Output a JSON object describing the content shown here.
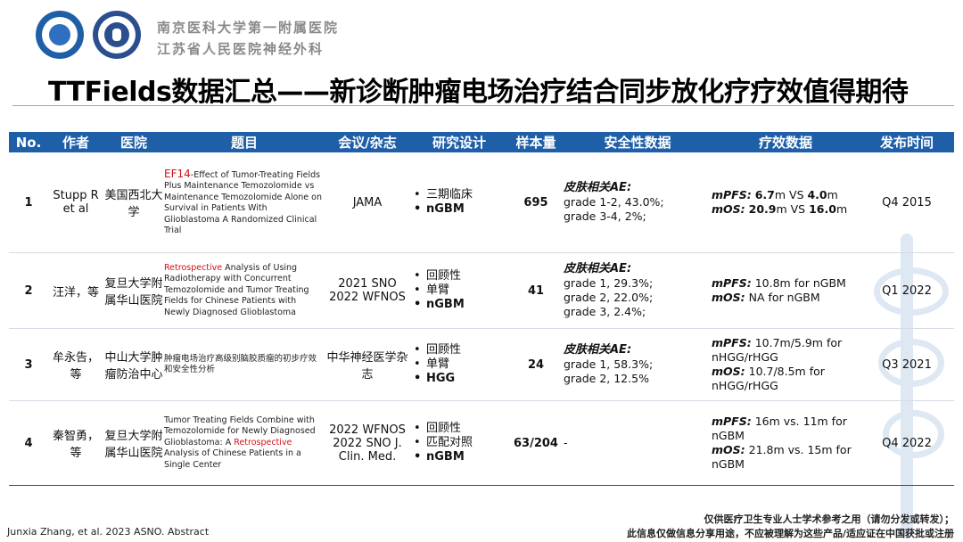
{
  "header": {
    "hospital_line1": "南京医科大学第一附属医院",
    "hospital_line2": "江苏省人民医院神经外科"
  },
  "title": "TTFields数据汇总——新诊断肿瘤电场治疗结合同步放化疗疗效值得期待",
  "table": {
    "headers": [
      "No.",
      "作者",
      "医院",
      "题目",
      "会议/杂志",
      "研究设计",
      "样本量",
      "安全性数据",
      "疗效数据",
      "发布时间"
    ],
    "rows": [
      {
        "no": "1",
        "author": "Stupp R et al",
        "hospital": "美国西北大学",
        "title_red": "EF14",
        "title_rest": "-Effect of Tumor-Treating Fields Plus Maintenance Temozolomide vs Maintenance Temozolomide Alone on Survival in Patients With Glioblastoma A Randomized Clinical Trial",
        "journal": "JAMA",
        "design": [
          "三期临床",
          "nGBM"
        ],
        "sample": "695",
        "safety_head": "皮肤相关AE:",
        "safety": [
          "grade 1-2, 43.0%;",
          "grade 3-4, 2%;"
        ],
        "efficacy": {
          "pfs_label": "mPFS:",
          "pfs_a": "6.7",
          "pfs_mid": "m VS ",
          "pfs_b": "4.0",
          "pfs_end": "m",
          "os_label": "mOS:",
          "os_a": "20.9",
          "os_mid": "m VS ",
          "os_b": "16.0",
          "os_end": "m"
        },
        "date": "Q4 2015"
      },
      {
        "no": "2",
        "author": "汪洋，等",
        "hospital": "复旦大学附属华山医院",
        "title_red": "Retrospective",
        "title_rest": " Analysis of Using Radiotherapy with Concurrent Temozolomide and Tumor Treating Fields for Chinese Patients with Newly Diagnosed Glioblastoma",
        "journal": "2021 SNO 2022 WFNOS",
        "design": [
          "回顾性",
          "单臂",
          "nGBM"
        ],
        "sample": "41",
        "safety_head": "皮肤相关AE:",
        "safety": [
          "grade 1, 29.3%;",
          "grade 2, 22.0%;",
          "grade 3, 2.4%;"
        ],
        "efficacy": {
          "pfs_label": "mPFS:",
          "pfs_text": " 10.8m for nGBM",
          "os_label": "mOS:",
          "os_text": " NA for nGBM"
        },
        "date": "Q1 2022"
      },
      {
        "no": "3",
        "author": "牟永告，等",
        "hospital": "中山大学肿瘤防治中心",
        "title_text": "肿瘤电场治疗高级别脑胶质瘤的初步疗效和安全性分析",
        "journal": "中华神经医学杂志",
        "design": [
          "回顾性",
          "单臂",
          "HGG"
        ],
        "sample": "24",
        "safety_head": "皮肤相关AE:",
        "safety": [
          "grade 1, 58.3%;",
          "grade 2, 12.5%"
        ],
        "efficacy": {
          "pfs_label": "mPFS:",
          "pfs_text": " 10.7m/5.9m for nHGG/rHGG",
          "os_label": "mOS:",
          "os_text": " 10.7/8.5m for nHGG/rHGG"
        },
        "date": "Q3 2021"
      },
      {
        "no": "4",
        "author": "秦智勇，等",
        "hospital": "复旦大学附属华山医院",
        "title_pre": "Tumor Treating Fields Combine with Temozolomide for Newly Diagnosed Glioblastoma: A ",
        "title_red": "Retrospective",
        "title_rest": " Analysis of Chinese Patients in a Single Center",
        "journal": "2022 WFNOS 2022 SNO J. Clin. Med.",
        "design": [
          "回顾性",
          "匹配对照",
          "nGBM"
        ],
        "sample": "63/204",
        "safety_text": "-",
        "efficacy": {
          "pfs_label": "mPFS:",
          "pfs_text": " 16m vs. 11m for nGBM",
          "os_label": "mOS:",
          "os_text": " 21.8m vs. 15m for nGBM"
        },
        "date": "Q4 2022"
      }
    ]
  },
  "footer": {
    "source": "Junxia Zhang, et al. 2023 ASNO. Abstract",
    "disclaimer1": "仅供医疗卫生专业人士学术参考之用（请勿分发或转发）；",
    "disclaimer2": "此信息仅做信息分享用途，不应被理解为这些产品/适应证在中国获批或注册"
  }
}
